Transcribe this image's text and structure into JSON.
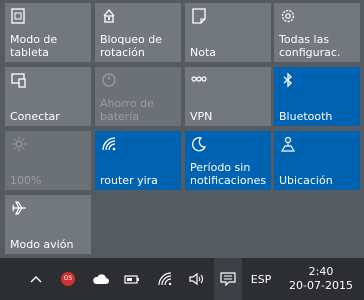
{
  "tiles": [
    {
      "label": "Modo de\ntableta",
      "icon": "tablet-mode-icon"
    },
    {
      "label": "Bloqueo de\nrotación",
      "icon": "rotation-lock-icon"
    },
    {
      "label": "Nota",
      "icon": "note-icon"
    },
    {
      "label": "Todas las\nconfigurac.",
      "icon": "settings-icon"
    },
    {
      "label": "Conectar",
      "icon": "connect-icon"
    },
    {
      "label": "Ahorro de\nbatería",
      "icon": "battery-saver-icon"
    },
    {
      "label": "VPN",
      "icon": "vpn-icon"
    },
    {
      "label": "Bluetooth",
      "icon": "bluetooth-icon"
    },
    {
      "label": "100%",
      "icon": "brightness-icon"
    },
    {
      "label": "router yira",
      "icon": "wifi-icon"
    },
    {
      "label": "Período sin\nnotificaciones",
      "icon": "quiet-hours-icon"
    },
    {
      "label": "Ubicación",
      "icon": "location-icon"
    },
    {
      "label": "Modo avión",
      "icon": "airplane-icon"
    }
  ],
  "taskbar": {
    "badge_text": "OS",
    "language": "ESP",
    "time": "2:40",
    "date": "20-07-2015"
  },
  "colors": {
    "tile_on": "#0063b1",
    "tile_off": "#73787e",
    "panel_bg": "#555b61",
    "taskbar_bg": "#2c2e31"
  }
}
